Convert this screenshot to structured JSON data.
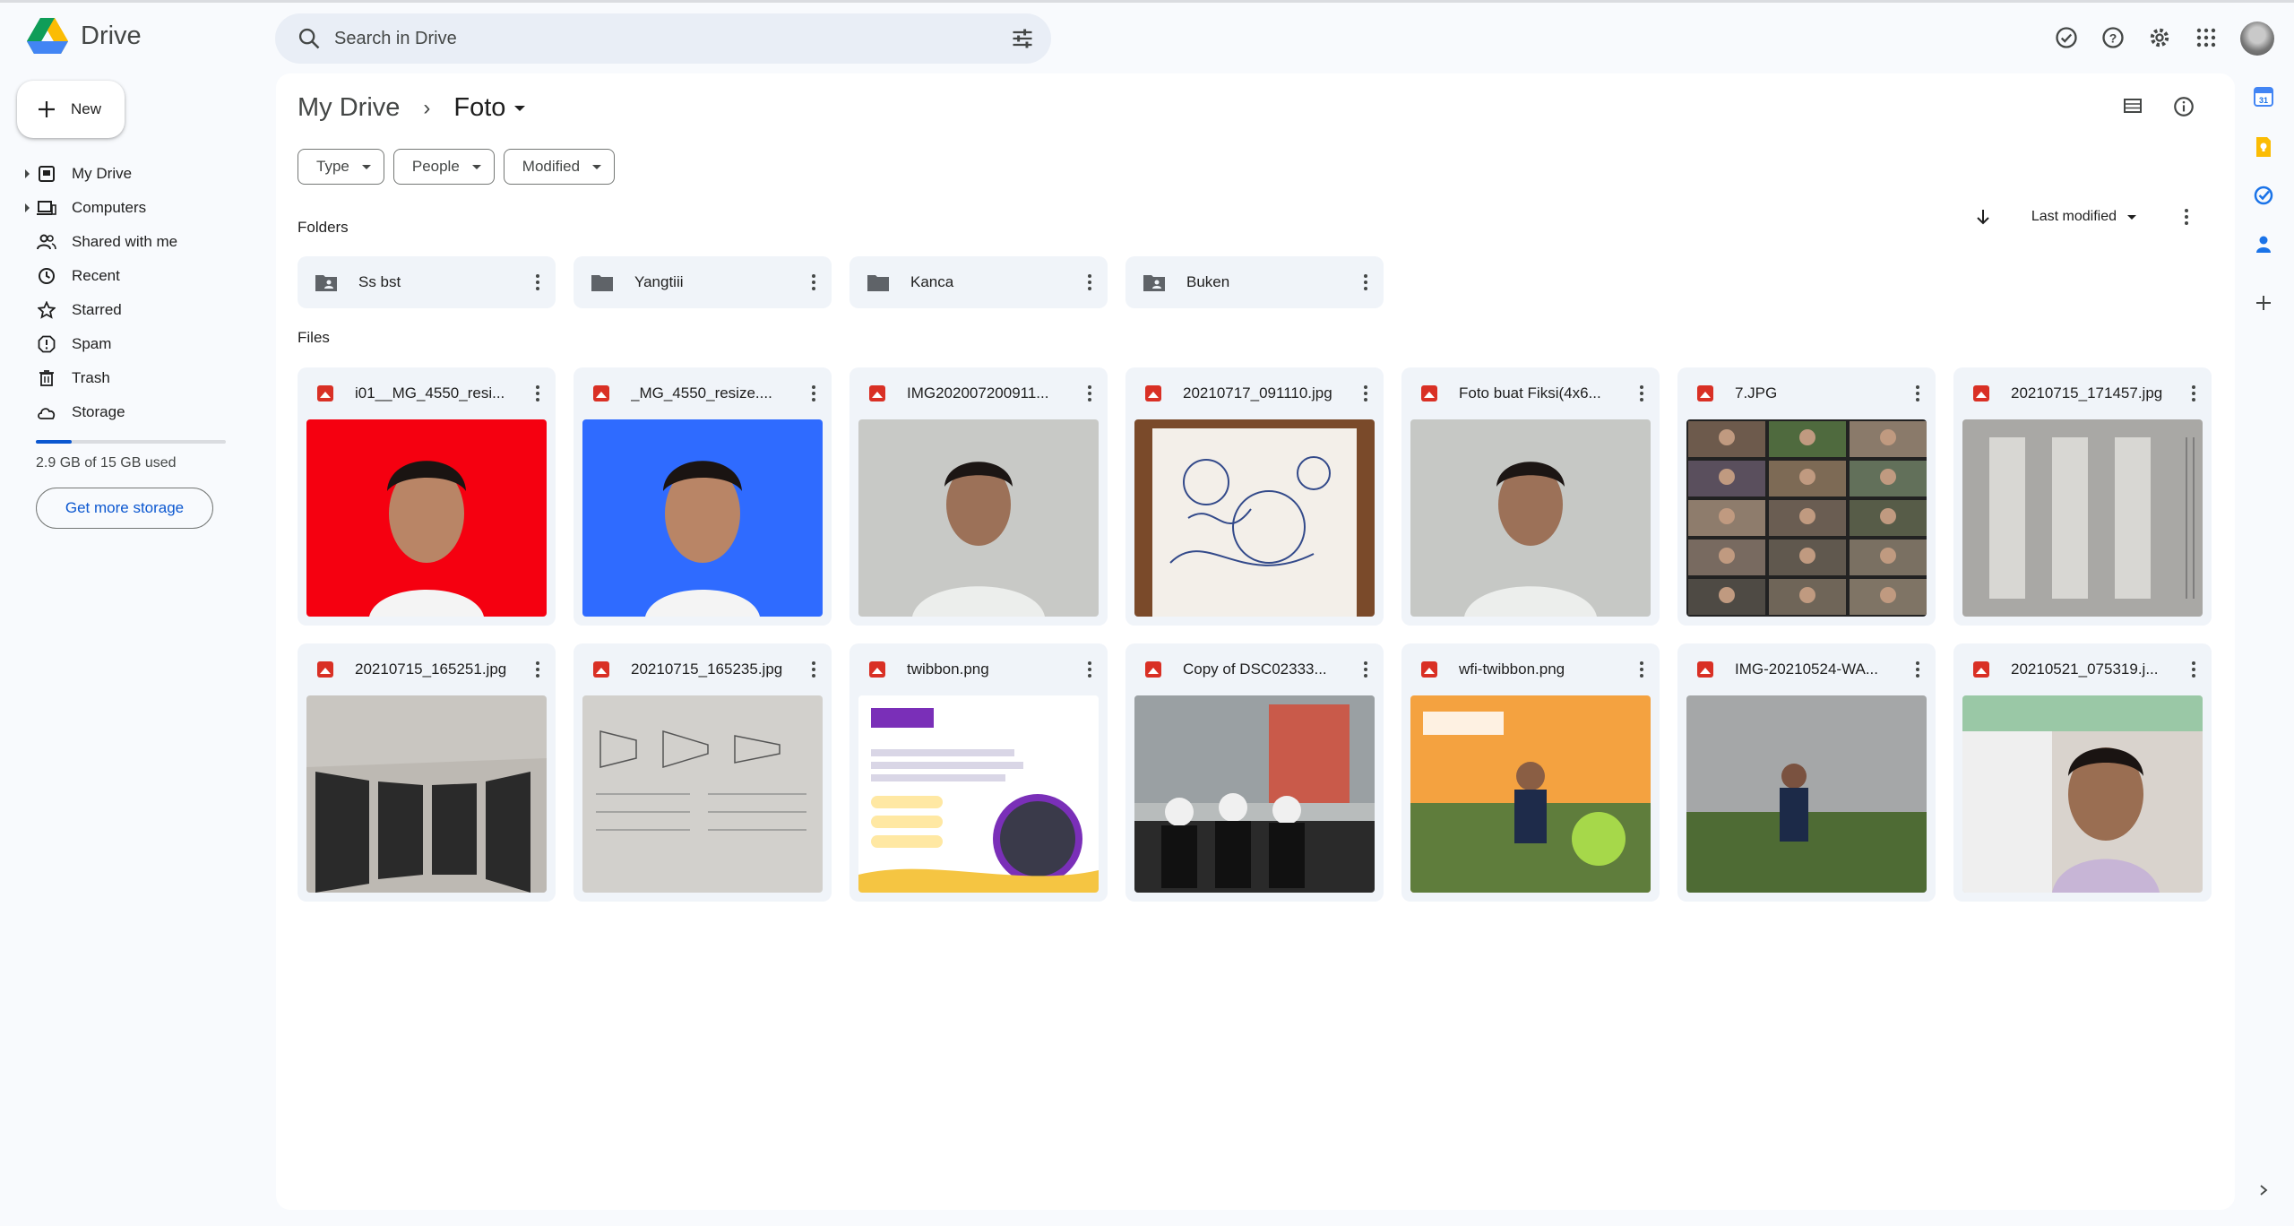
{
  "app": {
    "name": "Drive"
  },
  "search": {
    "placeholder": "Search in Drive"
  },
  "sidebar": {
    "new_label": "New",
    "items": [
      {
        "label": "My Drive"
      },
      {
        "label": "Computers"
      },
      {
        "label": "Shared with me"
      },
      {
        "label": "Recent"
      },
      {
        "label": "Starred"
      },
      {
        "label": "Spam"
      },
      {
        "label": "Trash"
      },
      {
        "label": "Storage"
      }
    ],
    "storage_text": "2.9 GB of 15 GB used",
    "storage_used_fraction": 0.19,
    "get_storage_label": "Get more storage"
  },
  "breadcrumb": {
    "root": "My Drive",
    "current": "Foto"
  },
  "filters": {
    "type": "Type",
    "people": "People",
    "modified": "Modified"
  },
  "sections": {
    "folders": "Folders",
    "files": "Files"
  },
  "sort": {
    "label": "Last modified"
  },
  "folders": [
    {
      "name": "Ss bst",
      "shared": true
    },
    {
      "name": "Yangtiii",
      "shared": false
    },
    {
      "name": "Kanca",
      "shared": false
    },
    {
      "name": "Buken",
      "shared": true
    }
  ],
  "files": [
    {
      "name": "i01__MG_4550_resi..."
    },
    {
      "name": "_MG_4550_resize...."
    },
    {
      "name": "IMG202007200911..."
    },
    {
      "name": "20210717_091110.jpg"
    },
    {
      "name": "Foto buat Fiksi(4x6..."
    },
    {
      "name": "7.JPG"
    },
    {
      "name": "20210715_171457.jpg"
    },
    {
      "name": "20210715_165251.jpg"
    },
    {
      "name": "20210715_165235.jpg"
    },
    {
      "name": "twibbon.png"
    },
    {
      "name": "Copy of DSC02333..."
    },
    {
      "name": "wfi-twibbon.png"
    },
    {
      "name": "IMG-20210524-WA..."
    },
    {
      "name": "20210521_075319.j..."
    }
  ],
  "colors": {
    "accent": "#0b57d0",
    "image_icon": "#d93025",
    "panel": "#f0f4f9"
  }
}
